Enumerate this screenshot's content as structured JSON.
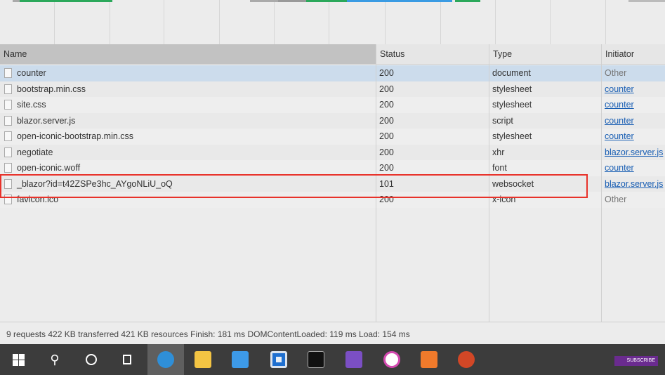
{
  "columns": {
    "name": "Name",
    "status": "Status",
    "type": "Type",
    "initiator": "Initiator"
  },
  "requests": [
    {
      "name": "counter",
      "status": "200",
      "type": "document",
      "initiator": "Other",
      "initiator_link": false,
      "selected": true
    },
    {
      "name": "bootstrap.min.css",
      "status": "200",
      "type": "stylesheet",
      "initiator": "counter",
      "initiator_link": true
    },
    {
      "name": "site.css",
      "status": "200",
      "type": "stylesheet",
      "initiator": "counter",
      "initiator_link": true
    },
    {
      "name": "blazor.server.js",
      "status": "200",
      "type": "script",
      "initiator": "counter",
      "initiator_link": true
    },
    {
      "name": "open-iconic-bootstrap.min.css",
      "status": "200",
      "type": "stylesheet",
      "initiator": "counter",
      "initiator_link": true
    },
    {
      "name": "negotiate",
      "status": "200",
      "type": "xhr",
      "initiator": "blazor.server.js",
      "initiator_link": true
    },
    {
      "name": "open-iconic.woff",
      "status": "200",
      "type": "font",
      "initiator": "counter",
      "initiator_link": true
    },
    {
      "name": "_blazor?id=t42ZSPe3hc_AYgoNLiU_oQ",
      "status": "101",
      "type": "websocket",
      "initiator": "blazor.server.js",
      "initiator_link": true,
      "highlighted": true
    },
    {
      "name": "favicon.ico",
      "status": "200",
      "type": "x-icon",
      "initiator": "Other",
      "initiator_link": false
    }
  ],
  "summary": "9 requests  422 KB transferred  421 KB resources  Finish: 181 ms  DOMContentLoaded: 119 ms  Load: 154 ms",
  "taskbar": {
    "subscribe_label": "SUBSCRIBE",
    "apps": [
      "start",
      "search",
      "cortana",
      "task-view",
      "dev-browser",
      "file-explorer",
      "magnifier",
      "app-window",
      "terminal",
      "visual-studio",
      "itunes",
      "paint",
      "powerpoint"
    ]
  },
  "colors": {
    "highlight": "#e8322a",
    "link": "#1a5fb4",
    "selected_row": "#ccdcec"
  }
}
